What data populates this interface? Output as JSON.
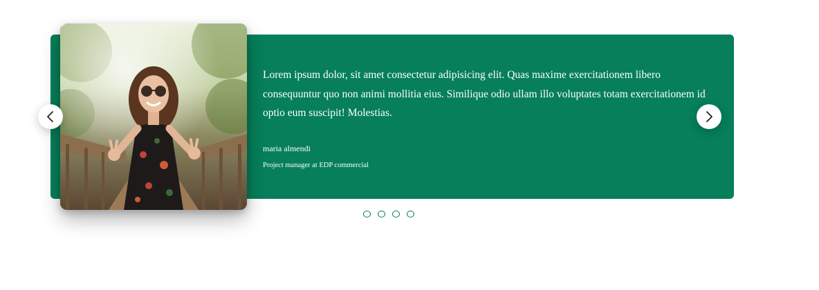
{
  "testimonial": {
    "quote": "Lorem ipsum dolor, sit amet consectetur adipisicing elit. Quas maxime exercitationem libero consequuntur quo non animi mollitia eius. Similique odio ullam illo voluptates totam exercitationem id optio eum suscipit! Molestias.",
    "author_name": "maria almendi",
    "author_role": "Project manager at EDP commercial"
  },
  "navigation": {
    "prev_icon": "chevron-left-icon",
    "next_icon": "chevron-right-icon"
  },
  "pagination": {
    "dot_count": 4
  },
  "colors": {
    "accent": "#067f5a",
    "text_on_accent": "#ffffff",
    "background": "#ffffff"
  }
}
